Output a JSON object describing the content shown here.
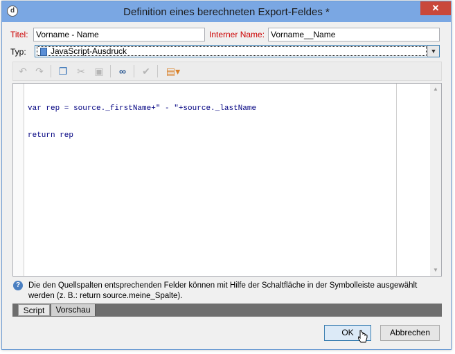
{
  "window": {
    "title": "Definition eines berechneten Export-Feldes *",
    "close_glyph": "✕",
    "app_icon_glyph": "d"
  },
  "form": {
    "titel_label": "Titel:",
    "titel_value": "Vorname - Name",
    "internal_label": "Interner Name:",
    "internal_value": "Vorname__Name",
    "typ_label": "Typ:",
    "typ_value": "JavaScript-Ausdruck"
  },
  "toolbar": {
    "icons": [
      "undo-icon",
      "redo-icon",
      "copy-icon",
      "cut-icon",
      "paste-icon",
      "find-icon",
      "validate-icon",
      "insert-field-icon"
    ]
  },
  "editor": {
    "lines": [
      "var rep = source._firstName+\" - \"+source._lastName",
      "return rep"
    ]
  },
  "hint": {
    "text": "Die den Quellspalten entsprechenden Felder können mit Hilfe der Schaltfläche in der Symbolleiste ausgewählt werden (z. B.: return source.meine_Spalte)."
  },
  "tabs": {
    "script": "Script",
    "preview": "Vorschau"
  },
  "buttons": {
    "ok": "OK",
    "cancel": "Abbrechen"
  },
  "colors": {
    "titlebar": "#7aa7e3",
    "close": "#c9483b",
    "label_red": "#cc0000",
    "code": "#000080"
  }
}
